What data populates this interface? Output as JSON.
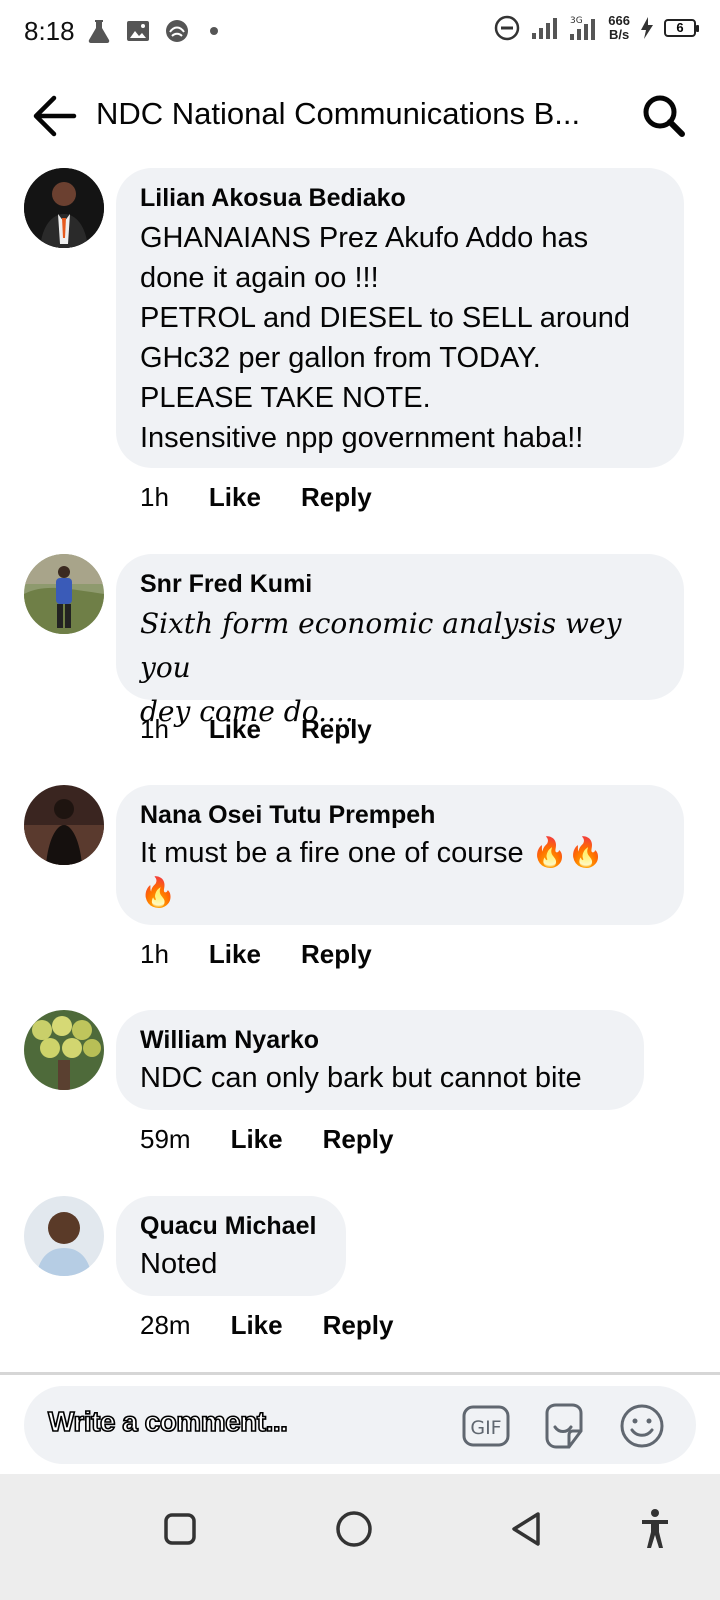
{
  "status_bar": {
    "time": "8:18",
    "speed_value": "666",
    "speed_unit": "B/s",
    "network": "3G",
    "battery": "6"
  },
  "header": {
    "title": "NDC National Communications B..."
  },
  "comments": [
    {
      "author": "Lilian Akosua Bediako",
      "text": "GHANAIANS  Prez Akufo Addo has\ndone it again oo !!!\nPETROL and DIESEL to SELL around\nGHc32 per gallon from TODAY.\nPLEASE TAKE NOTE.\nInsensitive npp government haba!!",
      "time": "1h",
      "like": "Like",
      "reply": "Reply"
    },
    {
      "author": "Snr Fred Kumi",
      "text": "Sixth form economic analysis wey you\ndey come do....",
      "time": "1h",
      "like": "Like",
      "reply": "Reply"
    },
    {
      "author": "Nana Osei Tutu Prempeh",
      "text": "It must be a fire one of course 🔥🔥\n🔥",
      "time": "1h",
      "like": "Like",
      "reply": "Reply"
    },
    {
      "author": "William Nyarko",
      "text": "NDC can only bark but cannot bite",
      "time": "59m",
      "like": "Like",
      "reply": "Reply"
    },
    {
      "author": "Quacu Michael",
      "text": "Noted",
      "time": "28m",
      "like": "Like",
      "reply": "Reply"
    }
  ],
  "composer": {
    "placeholder": "Write a comment...",
    "gif_label": "GIF"
  }
}
